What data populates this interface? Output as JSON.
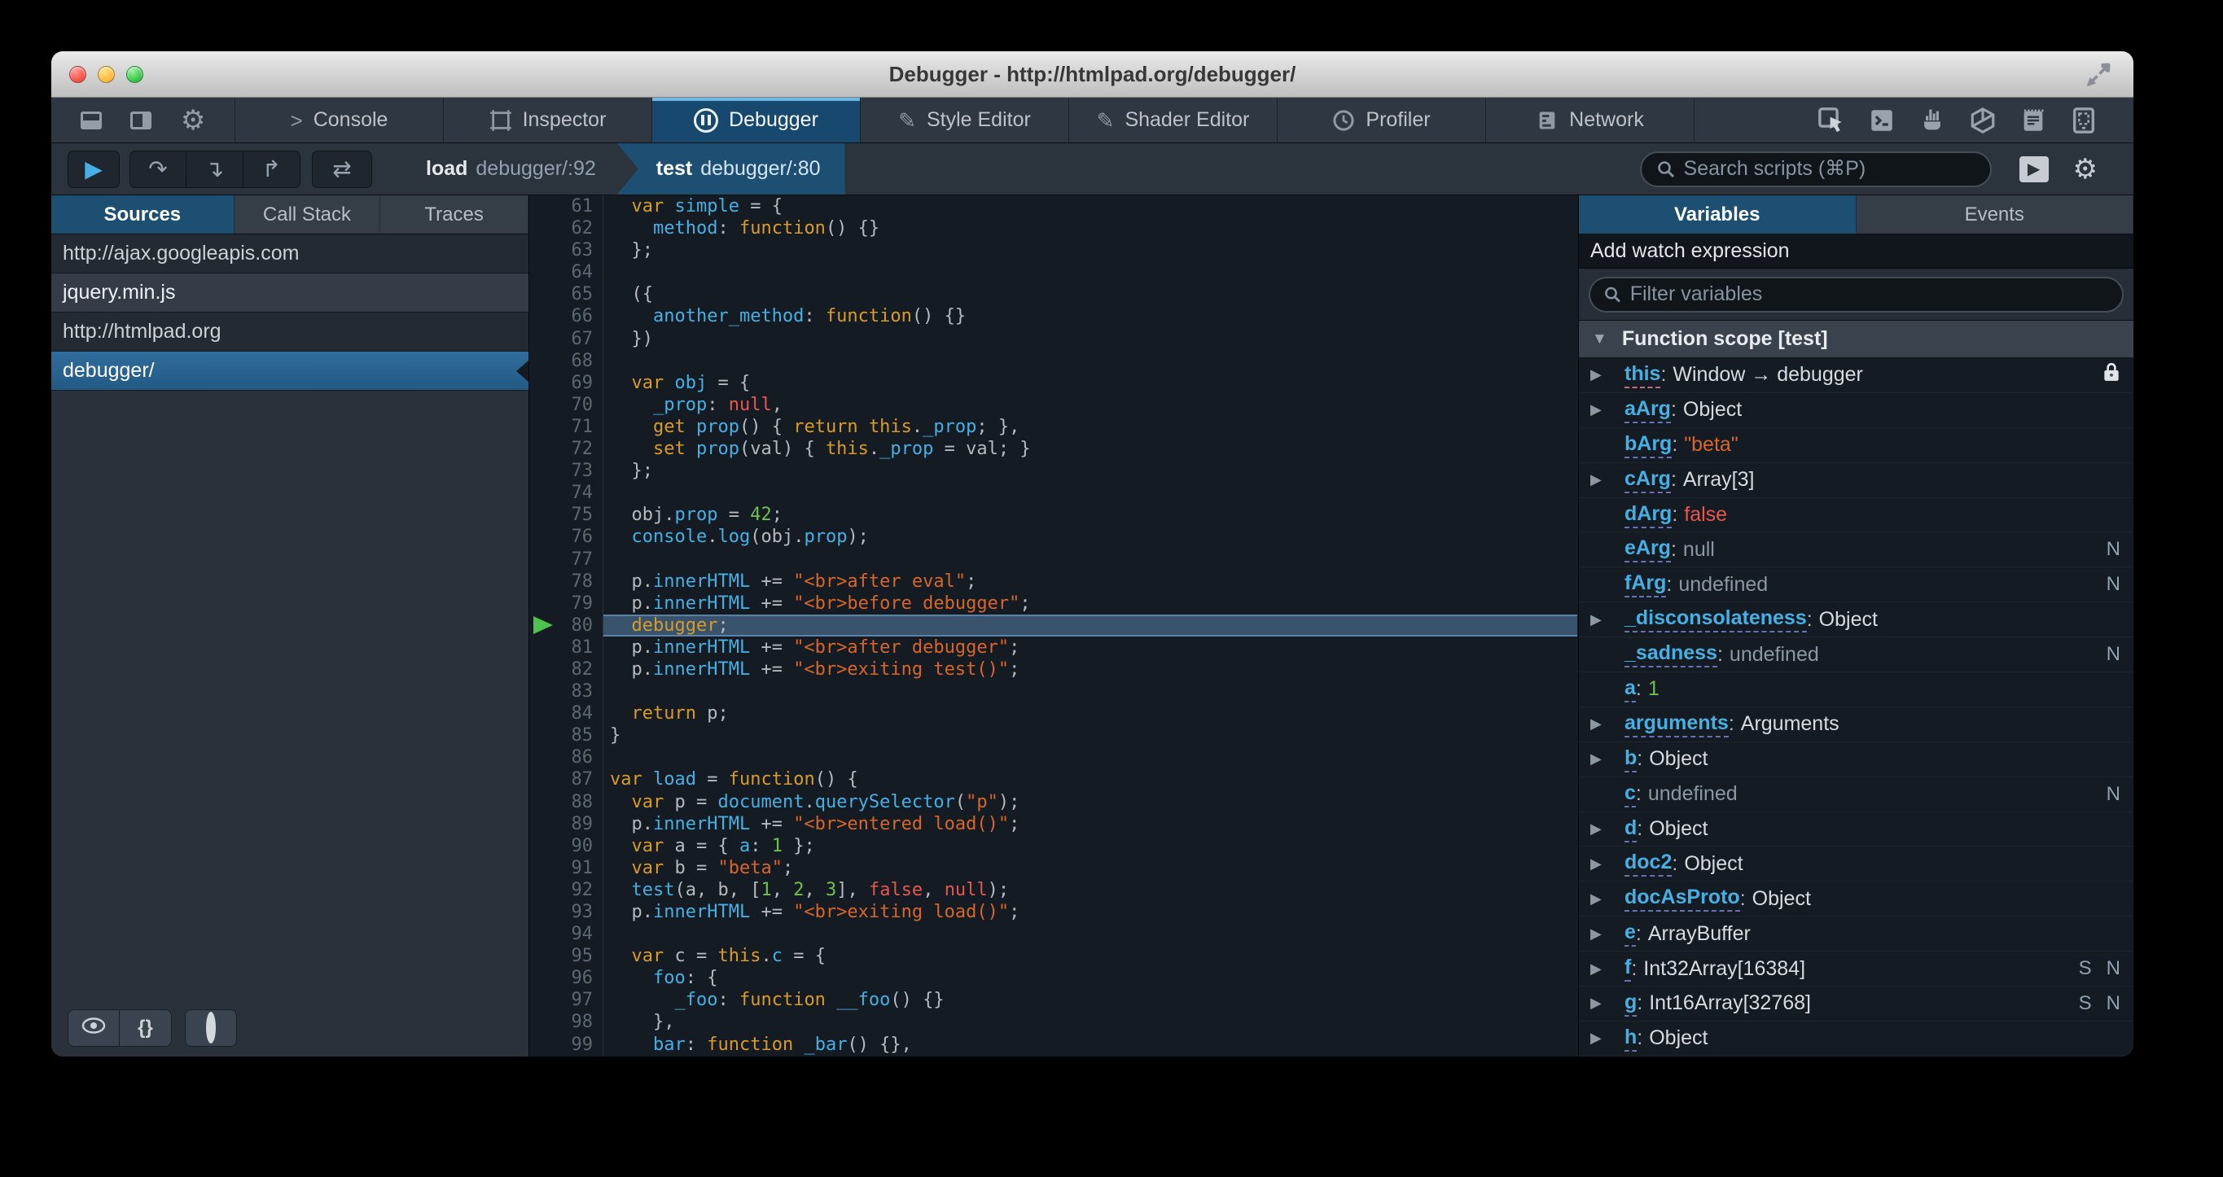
{
  "window": {
    "title": "Debugger - http://htmlpad.org/debugger/",
    "controls": [
      "close-button",
      "minimize-button",
      "zoom-button"
    ]
  },
  "main_toolbar": {
    "left_icons": [
      "dock-bottom-icon",
      "dock-side-icon",
      "settings-gear-icon"
    ],
    "tabs": [
      {
        "label": "Console",
        "icon": "console-chevron-icon",
        "active": false
      },
      {
        "label": "Inspector",
        "icon": "inspector-frame-icon",
        "active": false
      },
      {
        "label": "Debugger",
        "icon": "debugger-pause-icon",
        "active": true
      },
      {
        "label": "Style Editor",
        "icon": "edit-pencil-icon",
        "active": false
      },
      {
        "label": "Shader Editor",
        "icon": "edit-pencil-icon",
        "active": false
      },
      {
        "label": "Profiler",
        "icon": "profiler-clock-icon",
        "active": false
      },
      {
        "label": "Network",
        "icon": "network-bars-icon",
        "active": false
      }
    ],
    "right_icons": [
      "pick-element-icon",
      "split-console-icon",
      "paintbrush-icon",
      "tilt-3d-icon",
      "scratchpad-icon",
      "responsive-mode-icon"
    ]
  },
  "debugger_toolbar": {
    "resume_icon": "play-icon",
    "step_buttons": [
      {
        "name": "step-over-button",
        "icon": "step-over-icon"
      },
      {
        "name": "step-in-button",
        "icon": "step-in-icon"
      },
      {
        "name": "step-out-button",
        "icon": "step-out-icon"
      }
    ],
    "blackbox_icon": "swap-arrows-icon",
    "breadcrumbs": [
      {
        "fn": "load",
        "loc": "debugger/:92",
        "active": false
      },
      {
        "fn": "test",
        "loc": "debugger/:80",
        "active": true
      }
    ],
    "search_placeholder": "Search scripts (⌘P)"
  },
  "sources_panel": {
    "tabs": [
      {
        "label": "Sources",
        "active": true
      },
      {
        "label": "Call Stack",
        "active": false
      },
      {
        "label": "Traces",
        "active": false
      }
    ],
    "items": [
      {
        "label": "http://ajax.googleapis.com",
        "kind": "group",
        "selected": false
      },
      {
        "label": "jquery.min.js",
        "kind": "file",
        "selected": false
      },
      {
        "label": "http://htmlpad.org",
        "kind": "group",
        "selected": false
      },
      {
        "label": "debugger/",
        "kind": "file",
        "selected": true
      }
    ],
    "footer_buttons": [
      {
        "name": "blackbox-sources-button",
        "icon": "eye-icon",
        "label": ""
      },
      {
        "name": "pretty-print-button",
        "icon": "",
        "label": "{}"
      },
      {
        "name": "toggle-breakpoints-button",
        "icon": "ring-icon",
        "label": ""
      }
    ],
    "pretty_print_label": "{}"
  },
  "editor": {
    "current_line": 80,
    "lines": [
      {
        "n": 61,
        "seg": [
          [
            "p",
            "  "
          ],
          [
            "k",
            "var"
          ],
          [
            "p",
            " "
          ],
          [
            "v",
            "simple"
          ],
          [
            "p",
            " = {"
          ]
        ]
      },
      {
        "n": 62,
        "seg": [
          [
            "p",
            "    "
          ],
          [
            "v",
            "method"
          ],
          [
            "p",
            ": "
          ],
          [
            "k",
            "function"
          ],
          [
            "p",
            "() {}"
          ]
        ]
      },
      {
        "n": 63,
        "seg": [
          [
            "p",
            "  };"
          ]
        ]
      },
      {
        "n": 64,
        "seg": []
      },
      {
        "n": 65,
        "seg": [
          [
            "p",
            "  ({"
          ]
        ]
      },
      {
        "n": 66,
        "seg": [
          [
            "p",
            "    "
          ],
          [
            "v",
            "another_method"
          ],
          [
            "p",
            ": "
          ],
          [
            "k",
            "function"
          ],
          [
            "p",
            "() {}"
          ]
        ]
      },
      {
        "n": 67,
        "seg": [
          [
            "p",
            "  })"
          ]
        ]
      },
      {
        "n": 68,
        "seg": []
      },
      {
        "n": 69,
        "seg": [
          [
            "p",
            "  "
          ],
          [
            "k",
            "var"
          ],
          [
            "p",
            " "
          ],
          [
            "v",
            "obj"
          ],
          [
            "p",
            " = {"
          ]
        ]
      },
      {
        "n": 70,
        "seg": [
          [
            "p",
            "    "
          ],
          [
            "v",
            "_prop"
          ],
          [
            "p",
            ": "
          ],
          [
            "a",
            "null"
          ],
          [
            "p",
            ","
          ]
        ]
      },
      {
        "n": 71,
        "seg": [
          [
            "p",
            "    "
          ],
          [
            "k",
            "get"
          ],
          [
            "p",
            " "
          ],
          [
            "v",
            "prop"
          ],
          [
            "p",
            "() { "
          ],
          [
            "k",
            "return"
          ],
          [
            "p",
            " "
          ],
          [
            "k",
            "this"
          ],
          [
            "p",
            "."
          ],
          [
            "v",
            "_prop"
          ],
          [
            "p",
            "; },"
          ]
        ]
      },
      {
        "n": 72,
        "seg": [
          [
            "p",
            "    "
          ],
          [
            "k",
            "set"
          ],
          [
            "p",
            " "
          ],
          [
            "v",
            "prop"
          ],
          [
            "p",
            "(val) { "
          ],
          [
            "k",
            "this"
          ],
          [
            "p",
            "."
          ],
          [
            "v",
            "_prop"
          ],
          [
            "p",
            " = val; }"
          ]
        ]
      },
      {
        "n": 73,
        "seg": [
          [
            "p",
            "  };"
          ]
        ]
      },
      {
        "n": 74,
        "seg": []
      },
      {
        "n": 75,
        "seg": [
          [
            "p",
            "  obj."
          ],
          [
            "v",
            "prop"
          ],
          [
            "p",
            " = "
          ],
          [
            "n",
            "42"
          ],
          [
            "p",
            ";"
          ]
        ]
      },
      {
        "n": 76,
        "seg": [
          [
            "p",
            "  "
          ],
          [
            "v",
            "console"
          ],
          [
            "p",
            "."
          ],
          [
            "v",
            "log"
          ],
          [
            "p",
            "(obj."
          ],
          [
            "v",
            "prop"
          ],
          [
            "p",
            ");"
          ]
        ]
      },
      {
        "n": 77,
        "seg": []
      },
      {
        "n": 78,
        "seg": [
          [
            "p",
            "  p."
          ],
          [
            "v",
            "innerHTML"
          ],
          [
            "p",
            " += "
          ],
          [
            "s",
            "\"<br>after eval\""
          ],
          [
            "p",
            ";"
          ]
        ]
      },
      {
        "n": 79,
        "seg": [
          [
            "p",
            "  p."
          ],
          [
            "v",
            "innerHTML"
          ],
          [
            "p",
            " += "
          ],
          [
            "s",
            "\"<br>before debugger\""
          ],
          [
            "p",
            ";"
          ]
        ]
      },
      {
        "n": 80,
        "seg": [
          [
            "p",
            "  "
          ],
          [
            "k",
            "debugger"
          ],
          [
            "p",
            ";"
          ]
        ]
      },
      {
        "n": 81,
        "seg": [
          [
            "p",
            "  p."
          ],
          [
            "v",
            "innerHTML"
          ],
          [
            "p",
            " += "
          ],
          [
            "s",
            "\"<br>after debugger\""
          ],
          [
            "p",
            ";"
          ]
        ]
      },
      {
        "n": 82,
        "seg": [
          [
            "p",
            "  p."
          ],
          [
            "v",
            "innerHTML"
          ],
          [
            "p",
            " += "
          ],
          [
            "s",
            "\"<br>exiting test()\""
          ],
          [
            "p",
            ";"
          ]
        ]
      },
      {
        "n": 83,
        "seg": []
      },
      {
        "n": 84,
        "seg": [
          [
            "p",
            "  "
          ],
          [
            "k",
            "return"
          ],
          [
            "p",
            " p;"
          ]
        ]
      },
      {
        "n": 85,
        "seg": [
          [
            "p",
            "}"
          ]
        ]
      },
      {
        "n": 86,
        "seg": []
      },
      {
        "n": 87,
        "seg": [
          [
            "k",
            "var"
          ],
          [
            "p",
            " "
          ],
          [
            "v",
            "load"
          ],
          [
            "p",
            " = "
          ],
          [
            "k",
            "function"
          ],
          [
            "p",
            "() {"
          ]
        ]
      },
      {
        "n": 88,
        "seg": [
          [
            "p",
            "  "
          ],
          [
            "k",
            "var"
          ],
          [
            "p",
            " p = "
          ],
          [
            "v",
            "document"
          ],
          [
            "p",
            "."
          ],
          [
            "v",
            "querySelector"
          ],
          [
            "p",
            "("
          ],
          [
            "s",
            "\"p\""
          ],
          [
            "p",
            ");"
          ]
        ]
      },
      {
        "n": 89,
        "seg": [
          [
            "p",
            "  p."
          ],
          [
            "v",
            "innerHTML"
          ],
          [
            "p",
            " += "
          ],
          [
            "s",
            "\"<br>entered load()\""
          ],
          [
            "p",
            ";"
          ]
        ]
      },
      {
        "n": 90,
        "seg": [
          [
            "p",
            "  "
          ],
          [
            "k",
            "var"
          ],
          [
            "p",
            " a = { "
          ],
          [
            "v",
            "a"
          ],
          [
            "p",
            ": "
          ],
          [
            "n",
            "1"
          ],
          [
            "p",
            " };"
          ]
        ]
      },
      {
        "n": 91,
        "seg": [
          [
            "p",
            "  "
          ],
          [
            "k",
            "var"
          ],
          [
            "p",
            " b = "
          ],
          [
            "s",
            "\"beta\""
          ],
          [
            "p",
            ";"
          ]
        ]
      },
      {
        "n": 92,
        "seg": [
          [
            "p",
            "  "
          ],
          [
            "v",
            "test"
          ],
          [
            "p",
            "(a, b, ["
          ],
          [
            "n",
            "1"
          ],
          [
            "p",
            ", "
          ],
          [
            "n",
            "2"
          ],
          [
            "p",
            ", "
          ],
          [
            "n",
            "3"
          ],
          [
            "p",
            "], "
          ],
          [
            "a",
            "false"
          ],
          [
            "p",
            ", "
          ],
          [
            "a",
            "null"
          ],
          [
            "p",
            ");"
          ]
        ]
      },
      {
        "n": 93,
        "seg": [
          [
            "p",
            "  p."
          ],
          [
            "v",
            "innerHTML"
          ],
          [
            "p",
            " += "
          ],
          [
            "s",
            "\"<br>exiting load()\""
          ],
          [
            "p",
            ";"
          ]
        ]
      },
      {
        "n": 94,
        "seg": []
      },
      {
        "n": 95,
        "seg": [
          [
            "p",
            "  "
          ],
          [
            "k",
            "var"
          ],
          [
            "p",
            " c = "
          ],
          [
            "k",
            "this"
          ],
          [
            "p",
            "."
          ],
          [
            "v",
            "c"
          ],
          [
            "p",
            " = {"
          ]
        ]
      },
      {
        "n": 96,
        "seg": [
          [
            "p",
            "    "
          ],
          [
            "v",
            "foo"
          ],
          [
            "p",
            ": {"
          ]
        ]
      },
      {
        "n": 97,
        "seg": [
          [
            "p",
            "      "
          ],
          [
            "v",
            "_foo"
          ],
          [
            "p",
            ": "
          ],
          [
            "k",
            "function"
          ],
          [
            "p",
            " "
          ],
          [
            "v",
            "__foo"
          ],
          [
            "p",
            "() {}"
          ]
        ]
      },
      {
        "n": 98,
        "seg": [
          [
            "p",
            "    },"
          ]
        ]
      },
      {
        "n": 99,
        "seg": [
          [
            "p",
            "    "
          ],
          [
            "v",
            "bar"
          ],
          [
            "p",
            ": "
          ],
          [
            "k",
            "function"
          ],
          [
            "p",
            " "
          ],
          [
            "v",
            "_bar"
          ],
          [
            "p",
            "() {},"
          ]
        ]
      }
    ]
  },
  "variables_panel": {
    "tabs": [
      {
        "label": "Variables",
        "active": true
      },
      {
        "label": "Events",
        "active": false
      }
    ],
    "watch_label": "Add watch expression",
    "filter_placeholder": "Filter variables",
    "scope_label": "Function scope [test]",
    "variables": [
      {
        "name": "this",
        "value": "Window → debugger",
        "type": "obj",
        "expand": true,
        "lock": true,
        "underline": "pink",
        "badges": []
      },
      {
        "name": "aArg",
        "value": "Object",
        "type": "obj",
        "expand": true,
        "badges": []
      },
      {
        "name": "bArg",
        "value": "\"beta\"",
        "type": "str",
        "expand": false,
        "badges": []
      },
      {
        "name": "cArg",
        "value": "Array[3]",
        "type": "obj",
        "expand": true,
        "badges": []
      },
      {
        "name": "dArg",
        "value": "false",
        "type": "bool",
        "expand": false,
        "badges": []
      },
      {
        "name": "eArg",
        "value": "null",
        "type": "nul",
        "expand": false,
        "badges": [
          "N"
        ]
      },
      {
        "name": "fArg",
        "value": "undefined",
        "type": "nul",
        "expand": false,
        "badges": [
          "N"
        ]
      },
      {
        "name": "_disconsolateness",
        "value": "Object",
        "type": "obj",
        "expand": true,
        "badges": []
      },
      {
        "name": "_sadness",
        "value": "undefined",
        "type": "nul",
        "expand": false,
        "badges": [
          "N"
        ]
      },
      {
        "name": "a",
        "value": "1",
        "type": "num",
        "expand": false,
        "badges": []
      },
      {
        "name": "arguments",
        "value": "Arguments",
        "type": "obj",
        "expand": true,
        "badges": []
      },
      {
        "name": "b",
        "value": "Object",
        "type": "obj",
        "expand": true,
        "badges": []
      },
      {
        "name": "c",
        "value": "undefined",
        "type": "nul",
        "expand": false,
        "badges": [
          "N"
        ]
      },
      {
        "name": "d",
        "value": "Object",
        "type": "obj",
        "expand": true,
        "badges": []
      },
      {
        "name": "doc2",
        "value": "Object",
        "type": "obj",
        "expand": true,
        "badges": []
      },
      {
        "name": "docAsProto",
        "value": "Object",
        "type": "obj",
        "expand": true,
        "badges": []
      },
      {
        "name": "e",
        "value": "ArrayBuffer",
        "type": "obj",
        "expand": true,
        "badges": []
      },
      {
        "name": "f",
        "value": "Int32Array[16384]",
        "type": "obj",
        "expand": true,
        "badges": [
          "S",
          "N"
        ]
      },
      {
        "name": "g",
        "value": "Int16Array[32768]",
        "type": "obj",
        "expand": true,
        "badges": [
          "S",
          "N"
        ]
      },
      {
        "name": "h",
        "value": "Object",
        "type": "obj",
        "expand": true,
        "badges": []
      }
    ]
  },
  "colors": {
    "accent_blue": "#46afe3",
    "selection_blue": "#1d4f73",
    "keyword_gold": "#d99b28",
    "string_orange": "#d96629",
    "number_green": "#70bf53",
    "atom_red": "#e9564f",
    "exec_arrow_green": "#4ec24e"
  }
}
